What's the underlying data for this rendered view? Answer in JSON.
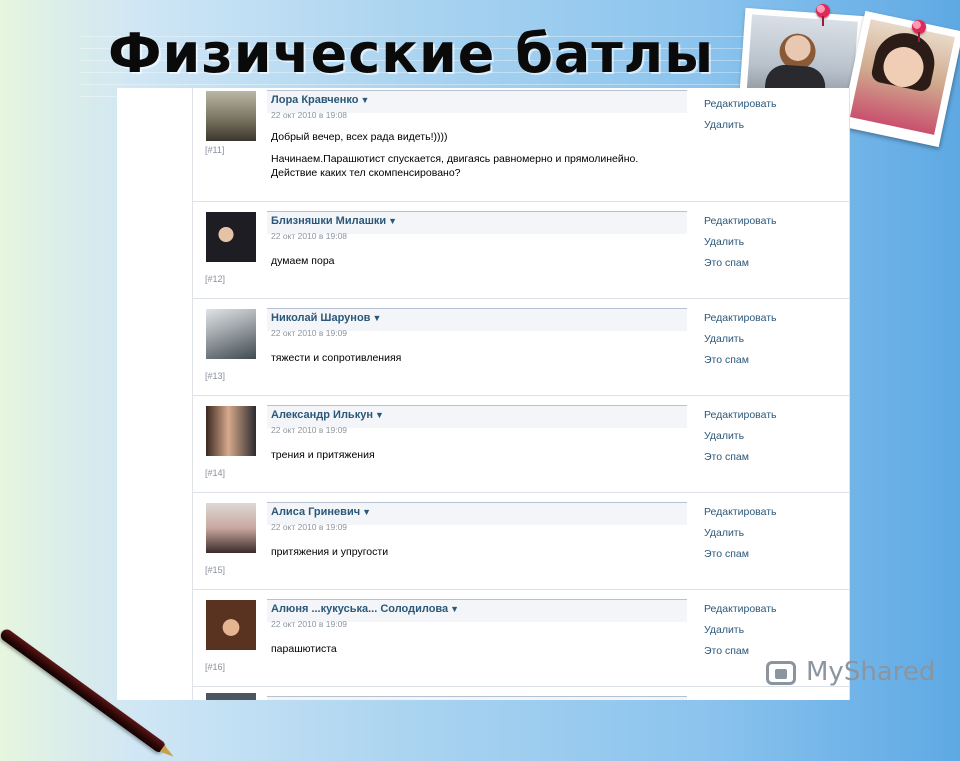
{
  "slide": {
    "title": "Физические батлы",
    "watermark": "MyShared"
  },
  "posts": [
    {
      "author": "Лора Кравченко",
      "date": "22 окт 2010 в 19:08",
      "number": "[#11]",
      "message": [
        "Добрый вечер, всех рада видеть!))))",
        "Начинаем.Парашютист спускается, двигаясь равномерно и прямолинейно. Действие каких тел скомпенсировано?"
      ],
      "actions": [
        "Редактировать",
        "Удалить"
      ]
    },
    {
      "author": "Близняшки Милашки",
      "date": "22 окт 2010 в 19:08",
      "number": "[#12]",
      "message": [
        "думаем пора"
      ],
      "actions": [
        "Редактировать",
        "Удалить",
        "Это спам"
      ]
    },
    {
      "author": "Николай Шарунов",
      "date": "22 окт 2010 в 19:09",
      "number": "[#13]",
      "message": [
        "тяжести и сопротивленияя"
      ],
      "actions": [
        "Редактировать",
        "Удалить",
        "Это спам"
      ]
    },
    {
      "author": "Александр Илькун",
      "date": "22 окт 2010 в 19:09",
      "number": "[#14]",
      "message": [
        "трения и притяжения"
      ],
      "actions": [
        "Редактировать",
        "Удалить",
        "Это спам"
      ]
    },
    {
      "author": "Алиса Гриневич",
      "date": "22 окт 2010 в 19:09",
      "number": "[#15]",
      "message": [
        "притяжения и упругости"
      ],
      "actions": [
        "Редактировать",
        "Удалить",
        "Это спам"
      ]
    },
    {
      "author": "Алюня ...кукуська... Солодилова",
      "date": "22 окт 2010 в 19:09",
      "number": "[#16]",
      "message": [
        "парашютиста"
      ],
      "actions": [
        "Редактировать",
        "Удалить",
        "Это спам"
      ]
    }
  ],
  "icons": {
    "dropdown": "caret-down-icon",
    "pin": "push-pin-icon",
    "pen": "fountain-pen-icon",
    "watermark": "myshared-logo-icon"
  },
  "colors": {
    "link": "#2b587a",
    "date": "#8d96a1",
    "background_right": "#5ea9e4",
    "background_left": "#e7f6df",
    "pin": "#e0295a"
  }
}
